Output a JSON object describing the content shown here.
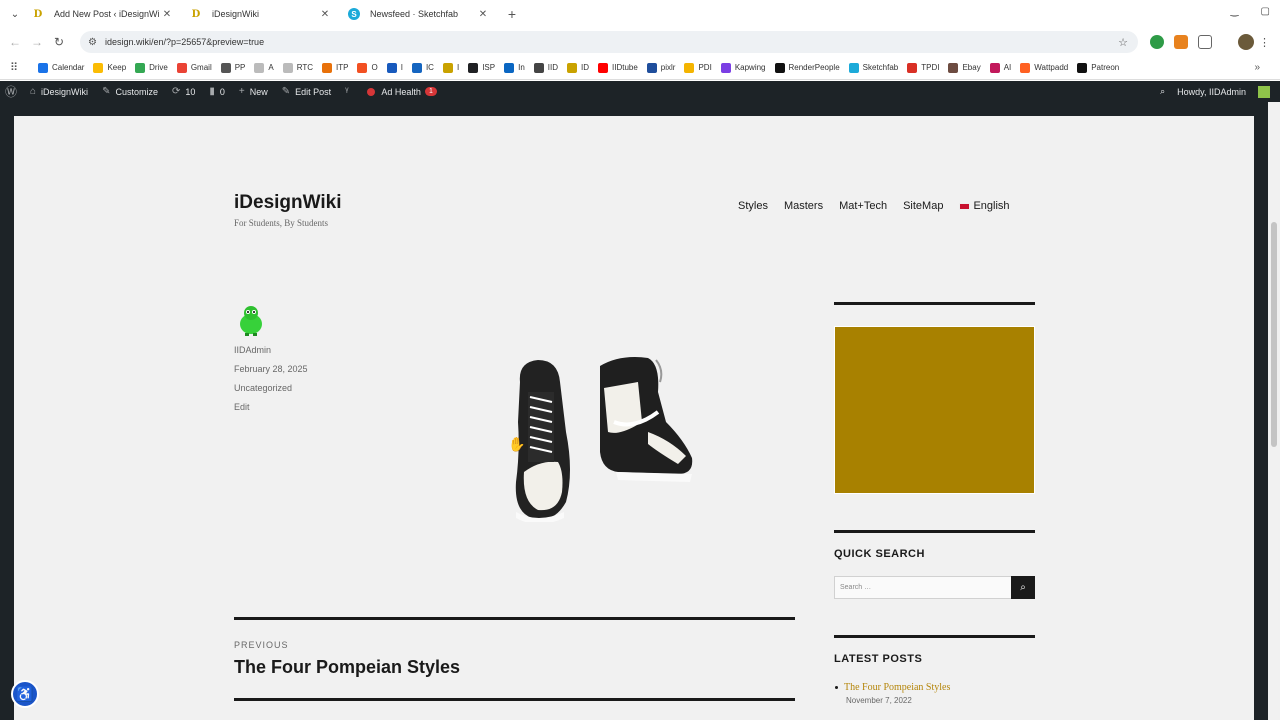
{
  "browser": {
    "tabs": [
      {
        "label": "Add New Post ‹ iDesignWiki",
        "favicon": "D"
      },
      {
        "label": "iDesignWiki",
        "favicon": "D"
      },
      {
        "label": "Newsfeed · Sketchfab",
        "favicon": "S"
      }
    ],
    "url": "idesign.wiki/en/?p=25657&preview=true",
    "bookmarks": [
      {
        "label": "Calendar",
        "color": "#1a73e8"
      },
      {
        "label": "Keep",
        "color": "#fbbc04"
      },
      {
        "label": "Drive",
        "color": "#34a853"
      },
      {
        "label": "Gmail",
        "color": "#ea4335"
      },
      {
        "label": "PP",
        "color": "#555555"
      },
      {
        "label": "A",
        "color": "#bbbbbb"
      },
      {
        "label": "RTC",
        "color": "#bbbbbb"
      },
      {
        "label": "ITP",
        "color": "#e8710a"
      },
      {
        "label": "O",
        "color": "#f25022"
      },
      {
        "label": "I",
        "color": "#185abd"
      },
      {
        "label": "IC",
        "color": "#1565c0"
      },
      {
        "label": "I",
        "color": "#c9a200"
      },
      {
        "label": "ISP",
        "color": "#202124"
      },
      {
        "label": "In",
        "color": "#0a66c2"
      },
      {
        "label": "IID",
        "color": "#444444"
      },
      {
        "label": "ID",
        "color": "#c9a200"
      },
      {
        "label": "IIDtube",
        "color": "#ff0000"
      },
      {
        "label": "pixlr",
        "color": "#1f4e9c"
      },
      {
        "label": "PDI",
        "color": "#f4b400"
      },
      {
        "label": "Kapwing",
        "color": "#7b3fe4"
      },
      {
        "label": "RenderPeople",
        "color": "#111111"
      },
      {
        "label": "Sketchfab",
        "color": "#1caad9"
      },
      {
        "label": "TPDI",
        "color": "#d93025"
      },
      {
        "label": "Ebay",
        "color": "#6d4c41"
      },
      {
        "label": "AI",
        "color": "#c2185b"
      },
      {
        "label": "Wattpadd",
        "color": "#ff6122"
      },
      {
        "label": "Patreon",
        "color": "#111111"
      }
    ]
  },
  "adminbar": {
    "site": "iDesignWiki",
    "customize": "Customize",
    "updates": "10",
    "comments": "0",
    "new": "New",
    "edit_post": "Edit Post",
    "ad_health": "Ad Health",
    "ad_health_count": "1",
    "howdy": "Howdy, IIDAdmin"
  },
  "site": {
    "title": "iDesignWiki",
    "tagline": "For Students, By Students",
    "nav": [
      "Styles",
      "Masters",
      "Mat+Tech",
      "SiteMap",
      "English"
    ]
  },
  "post": {
    "author": "IIDAdmin",
    "date": "February 28, 2025",
    "category": "Uncategorized",
    "edit": "Edit"
  },
  "post_nav": {
    "label": "PREVIOUS",
    "title": "The Four Pompeian Styles"
  },
  "sidebar": {
    "ad_color": "#a88100",
    "quick_search": "QUICK SEARCH",
    "search_placeholder": "Search …",
    "latest_posts": "LATEST POSTS",
    "latest": [
      {
        "title": "The Four Pompeian Styles",
        "date": "November 7, 2022"
      }
    ]
  }
}
